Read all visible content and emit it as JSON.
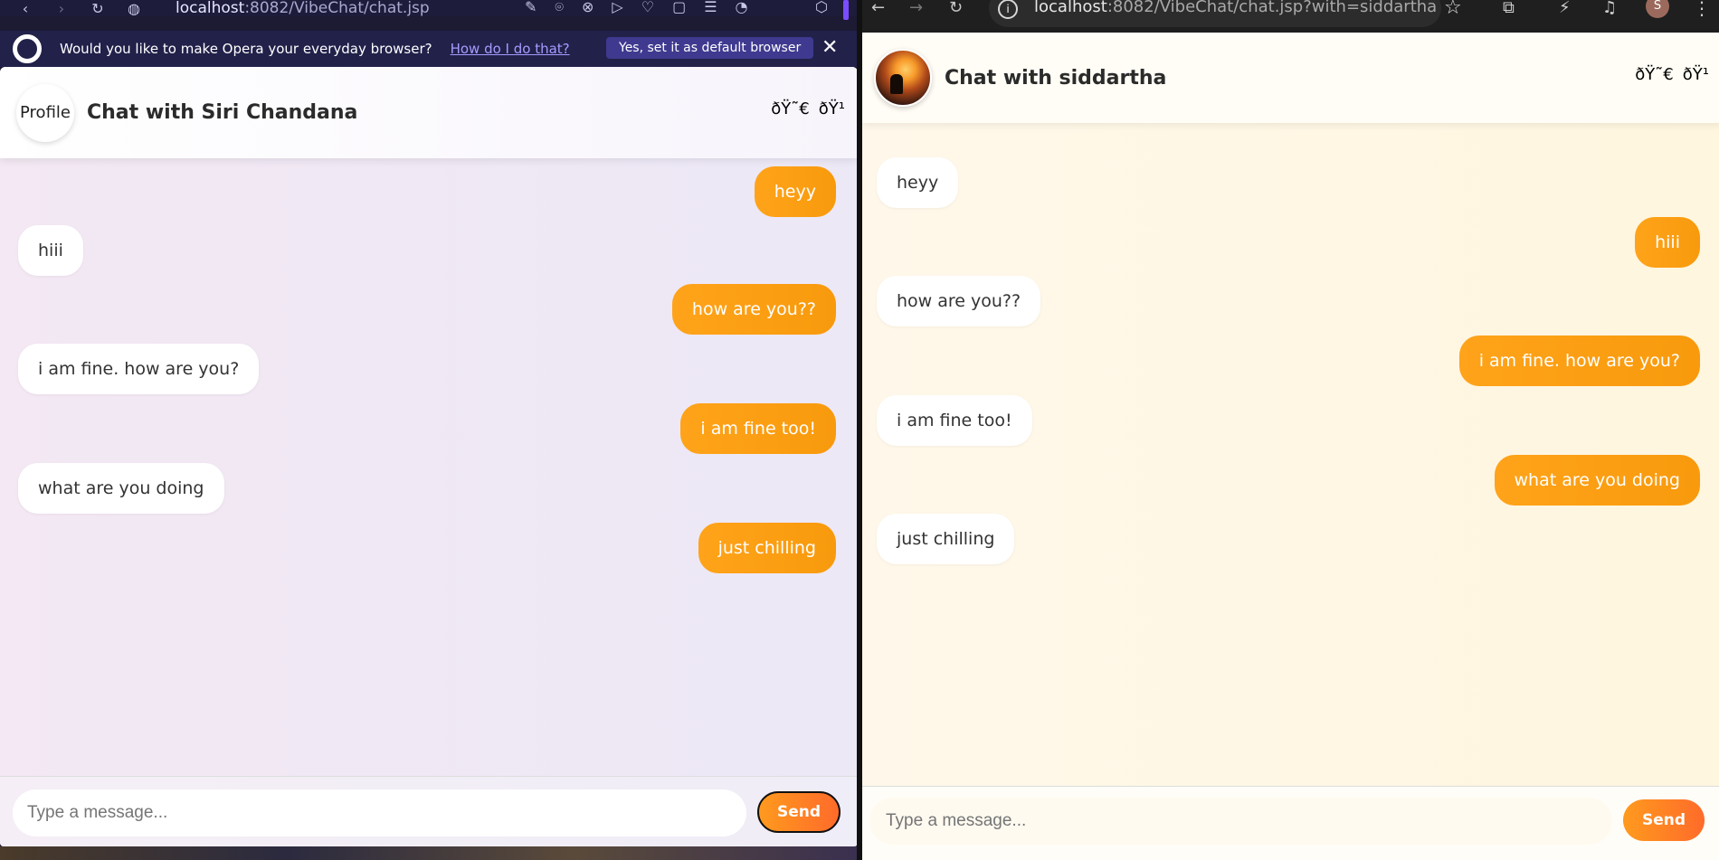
{
  "left_window": {
    "toolbar": {
      "back": "‹",
      "forward": "›",
      "reload": "↻",
      "url_host": "localhost",
      "url_rest": ":8082/VibeChat/chat.jsp",
      "globe_icon": "◍",
      "tool_icons": [
        "✎",
        "⌾",
        "⊗",
        "▷",
        "♡",
        "▢",
        "☰",
        "◔"
      ],
      "extensions_icon": "⬡"
    },
    "banner": {
      "text": "Would you like to make Opera your everyday browser?",
      "link": "How do I do that?",
      "default_button": "Yes, set it as default browser",
      "close": "✕"
    },
    "chat": {
      "avatar_alt": "Profile",
      "title": "Chat with Siri Chandana",
      "header_emoji_1": "ðŸ˜€",
      "header_emoji_2": "ðŸ¹",
      "messages": [
        {
          "side": "sent",
          "text": "heyy"
        },
        {
          "side": "recv",
          "text": "hiii"
        },
        {
          "side": "sent",
          "text": "how are you??"
        },
        {
          "side": "recv",
          "text": "i am fine. how are you?"
        },
        {
          "side": "sent",
          "text": "i am fine too!"
        },
        {
          "side": "recv",
          "text": "what are you doing"
        },
        {
          "side": "sent",
          "text": "just chilling"
        }
      ],
      "input_placeholder": "Type a message...",
      "send_label": "Send"
    }
  },
  "right_window": {
    "toolbar": {
      "back": "←",
      "forward": "→",
      "reload": "↻",
      "info": "i",
      "url_host": "localhost",
      "url_rest": ":8082/VibeChat/chat.jsp?with=siddartha",
      "star": "☆",
      "extensions_icon": "⧉",
      "performance_icon": "⚡",
      "media_icon": "♫",
      "profile_initial": "S",
      "menu_icon": "⋮"
    },
    "chat": {
      "title": "Chat with siddartha",
      "header_emoji_1": "ðŸ˜€",
      "header_emoji_2": "ðŸ¹",
      "messages": [
        {
          "side": "recv",
          "text": "heyy"
        },
        {
          "side": "sent",
          "text": "hiii"
        },
        {
          "side": "recv",
          "text": "how are you??"
        },
        {
          "side": "sent",
          "text": "i am fine. how are you?"
        },
        {
          "side": "recv",
          "text": "i am fine too!"
        },
        {
          "side": "sent",
          "text": "what are you doing"
        },
        {
          "side": "recv",
          "text": "just chilling"
        }
      ],
      "input_placeholder": "Type a message...",
      "send_label": "Send"
    }
  },
  "colors": {
    "accent_orange": "#FFA31A",
    "send_gradient_end": "#FF6B2A",
    "opera_bar": "#1D1C3B"
  }
}
